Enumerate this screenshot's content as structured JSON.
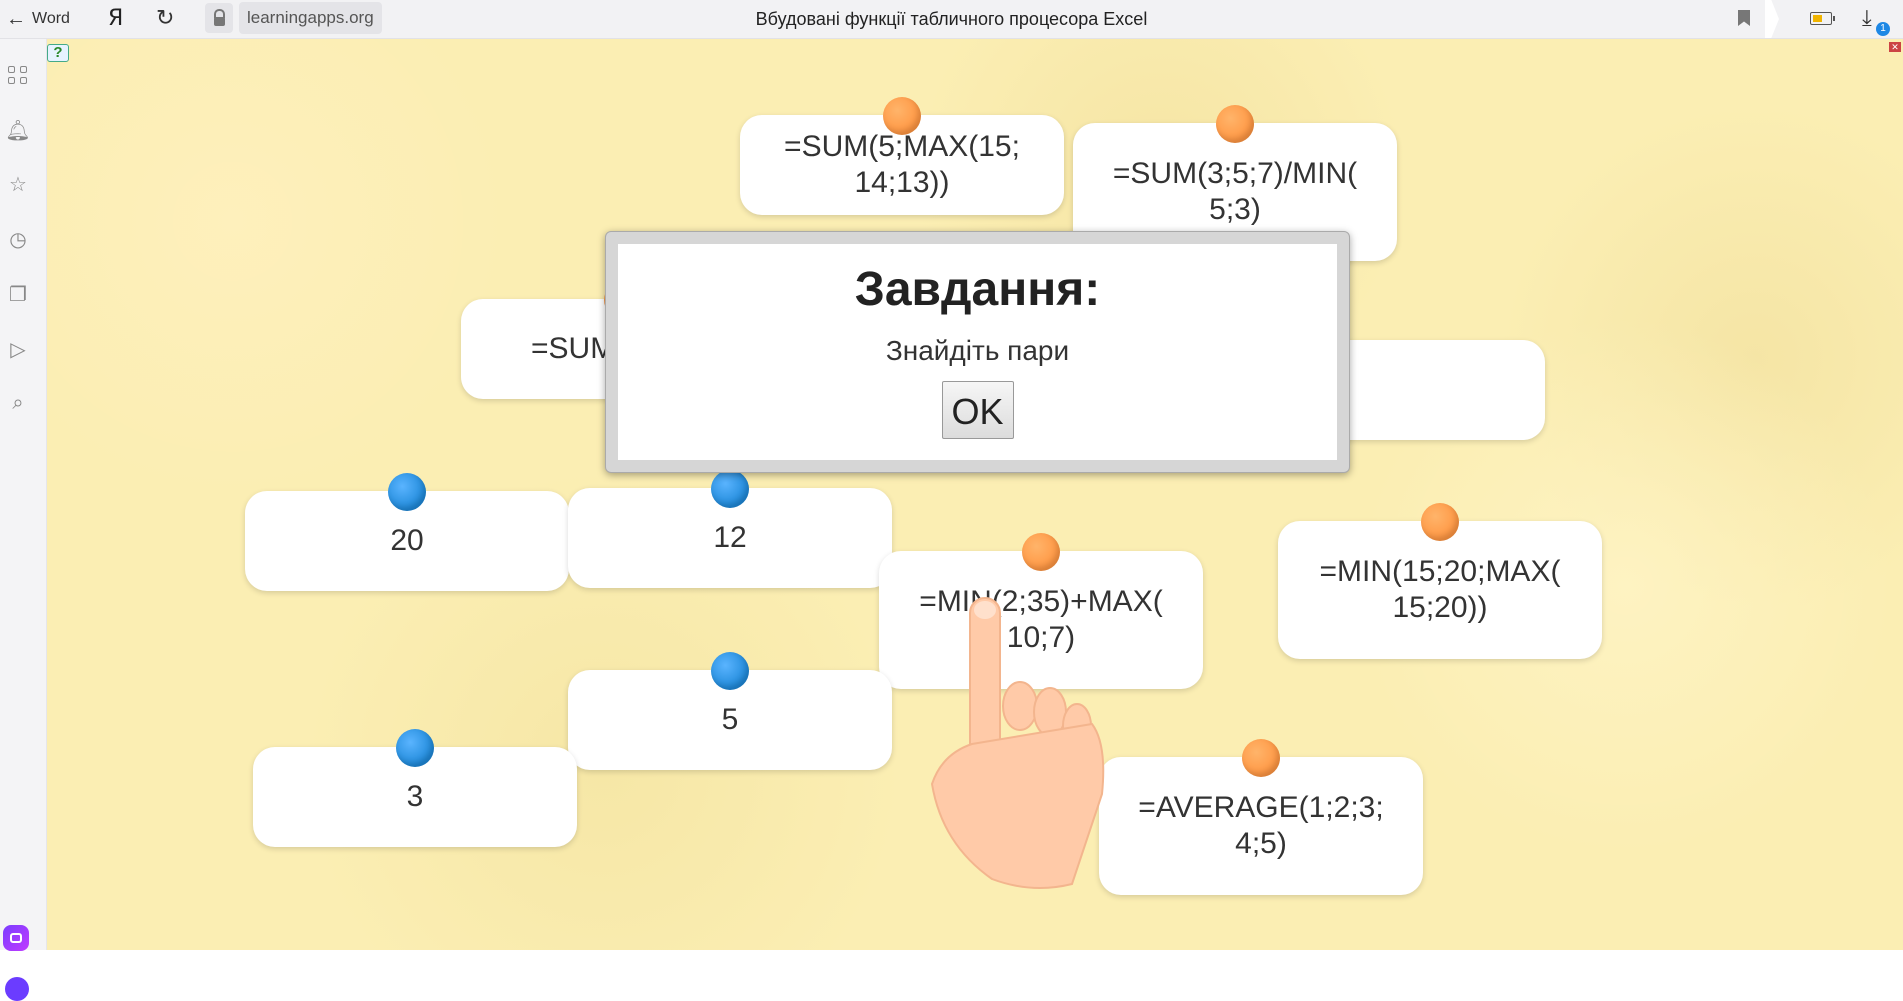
{
  "browser": {
    "back_label": "Word",
    "yandex_label": "Я",
    "url": "learningapps.org",
    "page_title": "Вбудовані функції табличного процесора Excel",
    "downloads_count": "1"
  },
  "colors": {
    "background": "#fbeeb3",
    "pin_blue": "#2a90e0",
    "pin_orange": "#ff9a48",
    "card": "#ffffff"
  },
  "game": {
    "help_icon": "help-icon",
    "cards": [
      {
        "text": "=SUM(5;MAX(15;\n14;13))",
        "pin": "orange"
      },
      {
        "text": "=SUM(3;5;7)/MIN(\n5;3)",
        "pin": "orange"
      },
      {
        "text": "=SUM",
        "pin": "orange"
      },
      {
        "text": "5",
        "pin": "blue"
      },
      {
        "text": "20",
        "pin": "blue"
      },
      {
        "text": "12",
        "pin": "blue"
      },
      {
        "text": "=MIN(2;35)+MAX(\n10;7)",
        "pin": "orange"
      },
      {
        "text": "=MIN(15;20;MAX(\n15;20))",
        "pin": "orange"
      },
      {
        "text": "5",
        "pin": "blue"
      },
      {
        "text": "3",
        "pin": "blue"
      },
      {
        "text": "=AVERAGE(1;2;3;\n4;5)",
        "pin": "orange"
      }
    ]
  },
  "dialog": {
    "title": "Завдання:",
    "message": "Знайдіть пари",
    "ok_label": "OK"
  }
}
